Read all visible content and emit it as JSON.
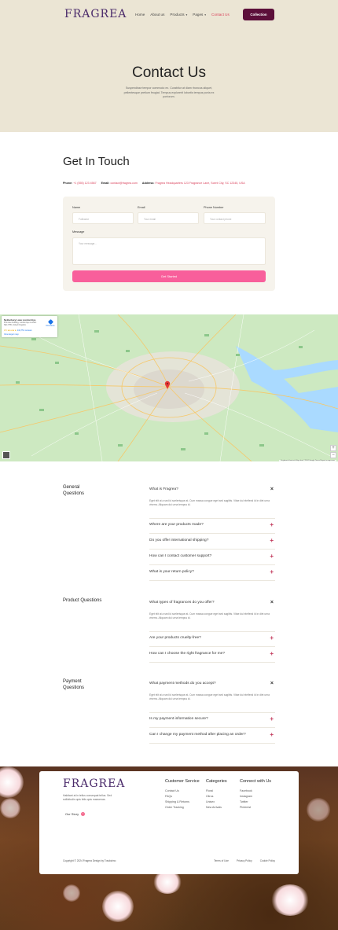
{
  "header": {
    "logo": "FRAGREA",
    "nav": [
      {
        "label": "Home",
        "dropdown": false,
        "active": false
      },
      {
        "label": "About us",
        "dropdown": false,
        "active": false
      },
      {
        "label": "Products",
        "dropdown": true,
        "active": false
      },
      {
        "label": "Pages",
        "dropdown": true,
        "active": false
      },
      {
        "label": "Contact Us",
        "dropdown": false,
        "active": true
      }
    ],
    "cta": "Collection"
  },
  "hero": {
    "title": "Contact Us",
    "subtitle": "Suspendisse tempor commodo ex. Curabitur at diam rhoncus aliquet, pellentesque pretium feugiat. Tempus explorerit lobortis tempus porta ex portorum."
  },
  "get_in_touch": {
    "title": "Get In Touch",
    "phone_label": "Phone:",
    "phone": "+1 (555) 123 4567",
    "email_label": "Email:",
    "email": "contact@fragrea.com",
    "address_label": "Address:",
    "address": "Fragrea Headquarters 123 Fragrance Lane, Scent City, SC 12345, USA"
  },
  "form": {
    "name_label": "Name",
    "name_placeholder": "Fullname",
    "email_label": "Email",
    "email_placeholder": "Your email",
    "phone_label": "Phone Number",
    "phone_placeholder": "Your contact phone",
    "message_label": "Message",
    "message_placeholder": "Your message...",
    "submit": "Get Started"
  },
  "map": {
    "place_name": "Netherbury Lane London Eye",
    "address": "Primrose building, London Eye London SE1 7PB, United Kingdom",
    "rating": "4.5 ★★★★★",
    "reviews": "142,751 reviews",
    "directions": "Directions",
    "larger_map": "View larger map",
    "zoom_in": "+",
    "zoom_out": "−",
    "attribution": "Keyboard shortcuts  Map data ©2024 Google  Terms  Report a map error"
  },
  "faq": [
    {
      "section": "General Questions",
      "items": [
        {
          "q": "What is Fragrea?",
          "open": true,
          "a": "Eget elit at a sed id scelerisque at. Cum massa congue eget sed sagittis. Vitae dui eleifend id in diet urna viverra. Aliquam dui urna tempus id."
        },
        {
          "q": "Where are your products made?",
          "open": false,
          "a": ""
        },
        {
          "q": "Do you offer international shipping?",
          "open": false,
          "a": ""
        },
        {
          "q": "How can I contact customer support?",
          "open": false,
          "a": ""
        },
        {
          "q": "What is your return policy?",
          "open": false,
          "a": ""
        }
      ]
    },
    {
      "section": "Product Questions",
      "items": [
        {
          "q": "What types of fragrances do you offer?",
          "open": true,
          "a": "Eget elit at a sed id scelerisque at. Cum massa congue eget sed sagittis. Vitae dui eleifend id in diet urna viverra. Aliquam dui urna tempus id."
        },
        {
          "q": "Are your products cruelty-free?",
          "open": false,
          "a": ""
        },
        {
          "q": "How can I choose the right fragrance for me?",
          "open": false,
          "a": ""
        }
      ]
    },
    {
      "section": "Payment Questions",
      "items": [
        {
          "q": "What payment methods do you accept?",
          "open": true,
          "a": "Eget elit at a sed id scelerisque at. Cum massa congue eget sed sagittis. Vitae dui eleifend id in diet urna viverra. Aliquam dui urna tempus id."
        },
        {
          "q": "Is my payment information secure?",
          "open": false,
          "a": ""
        },
        {
          "q": "Can I change my payment method after placing an order?",
          "open": false,
          "a": ""
        }
      ]
    }
  ],
  "footer": {
    "logo": "FRAGREA",
    "description": "Habitant at in tellus consequat tellus. Sed sollicitudin quis felis quis maecenas.",
    "story": "Our Story",
    "columns": [
      {
        "title": "Customer Service",
        "links": [
          "Contact Us",
          "FAQs",
          "Shipping & Returns",
          "Order Tracking"
        ]
      },
      {
        "title": "Categories",
        "links": [
          "Floral",
          "Citrus",
          "Unisex",
          "New Arrivals"
        ]
      },
      {
        "title": "Connect with Us",
        "links": [
          "Facebook",
          "Instagram",
          "Twitter",
          "Pinterest"
        ]
      }
    ],
    "copyright": "Copyright © 2024 Fragrea     Design by Tracksimo",
    "legal": [
      "Terms of Use",
      "Privacy Policy",
      "Cookie Policy"
    ]
  }
}
